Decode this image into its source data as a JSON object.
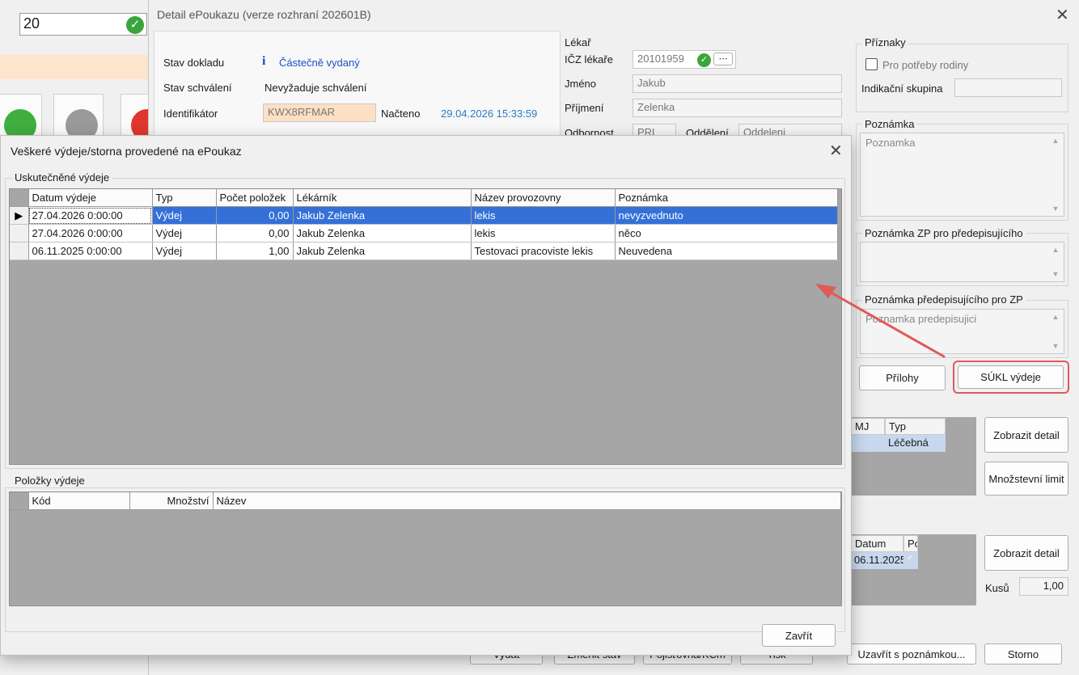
{
  "background": {
    "qty_value": "20"
  },
  "detail": {
    "title": "Detail ePoukazu (verze rozhraní 202601B)",
    "stav_dokladu_label": "Stav dokladu",
    "stav_dokladu_value": "Částečně vydaný",
    "stav_schvaleni_label": "Stav schválení",
    "stav_schvaleni_value": "Nevyžaduje schválení",
    "identifikator_label": "Identifikátor",
    "identifikator_value": "KWX8RFMAR",
    "nacteno_label": "Načteno",
    "nacteno_value": "29.04.2026 15:33:59",
    "lekar": {
      "group": "Lékař",
      "icz_label": "IČZ lékaře",
      "icz_value": "20101959",
      "jmeno_label": "Jméno",
      "jmeno_value": "Jakub",
      "prijmeni_label": "Příjmení",
      "prijmeni_value": "Zelenka",
      "odbornost_label": "Odbornost",
      "odbornost_value": "PRL",
      "oddeleni_label": "Oddělení",
      "oddeleni_value": "Oddeleni"
    },
    "priznaky": {
      "group": "Příznaky",
      "pro_potreby_rodiny": "Pro potřeby rodiny",
      "indikacni_skupina_label": "Indikační skupina",
      "indikacni_skupina_value": ""
    },
    "poznamka_group": "Poznámka",
    "poznamka_value": "Poznamka",
    "poznamka_zp_group": "Poznámka ZP pro předepisujícího",
    "poznamka_zp_value": "",
    "poznamka_pred_group": "Poznámka předepisujícího pro ZP",
    "poznamka_pred_value": "Poznamka predepisujici",
    "prilohy_button": "Přílohy",
    "sukl_button": "SÚKL výdeje",
    "items_grid": {
      "col_mj": "MJ",
      "col_typ": "Typ",
      "typ_value": "Léčebná"
    },
    "zobrazit_detail_button": "Zobrazit detail",
    "mnozstevni_limit_button": "Množstevní limit",
    "vydeje_grid": {
      "col_datum": "Datum",
      "col_po": "Po",
      "datum_value": "06.11.2025"
    },
    "zobrazit_detail2_button": "Zobrazit detail",
    "kusu_label": "Kusů",
    "kusu_value": "1,00",
    "bottom_buttons": [
      "Vydat",
      "Změnit stav",
      "Pojišťovna/KCm",
      "Tisk",
      "Uzavřít s poznámkou...",
      "Storno"
    ]
  },
  "modal": {
    "title": "Veškeré výdeje/storna provedené na ePoukaz",
    "group_vydeje": "Uskutečněné výdeje",
    "columns": [
      "Datum výdeje",
      "Typ",
      "Počet položek",
      "Lékárník",
      "Název provozovny",
      "Poznámka"
    ],
    "rows": [
      [
        "27.04.2026 0:00:00",
        "Výdej",
        "0,00",
        "Jakub Zelenka",
        "lekis",
        "nevyzvednuto"
      ],
      [
        "27.04.2026 0:00:00",
        "Výdej",
        "0,00",
        "Jakub Zelenka",
        "lekis",
        "něco"
      ],
      [
        "06.11.2025 0:00:00",
        "Výdej",
        "1,00",
        "Jakub Zelenka",
        "Testovaci pracoviste lekis",
        "Neuvedena"
      ]
    ],
    "group_polozky": "Položky výdeje",
    "polozky_columns": [
      "Kód",
      "Množství",
      "Název"
    ],
    "close_button": "Zavřít"
  },
  "colors": {
    "selection": "#3470d8",
    "status_blue": "#1a4fc4",
    "timestamp_blue": "#2a7bc8",
    "annotation_red": "#e05a5a",
    "identifier_bg": "#fde0c4"
  }
}
